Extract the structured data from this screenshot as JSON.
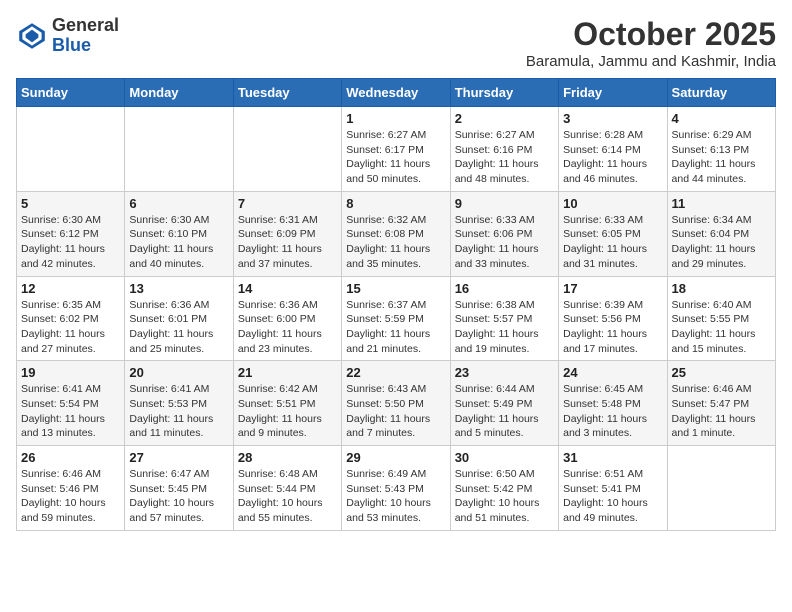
{
  "header": {
    "logo_general": "General",
    "logo_blue": "Blue",
    "month": "October 2025",
    "location": "Baramula, Jammu and Kashmir, India"
  },
  "weekdays": [
    "Sunday",
    "Monday",
    "Tuesday",
    "Wednesday",
    "Thursday",
    "Friday",
    "Saturday"
  ],
  "weeks": [
    [
      {
        "day": "",
        "info": ""
      },
      {
        "day": "",
        "info": ""
      },
      {
        "day": "",
        "info": ""
      },
      {
        "day": "1",
        "info": "Sunrise: 6:27 AM\nSunset: 6:17 PM\nDaylight: 11 hours\nand 50 minutes."
      },
      {
        "day": "2",
        "info": "Sunrise: 6:27 AM\nSunset: 6:16 PM\nDaylight: 11 hours\nand 48 minutes."
      },
      {
        "day": "3",
        "info": "Sunrise: 6:28 AM\nSunset: 6:14 PM\nDaylight: 11 hours\nand 46 minutes."
      },
      {
        "day": "4",
        "info": "Sunrise: 6:29 AM\nSunset: 6:13 PM\nDaylight: 11 hours\nand 44 minutes."
      }
    ],
    [
      {
        "day": "5",
        "info": "Sunrise: 6:30 AM\nSunset: 6:12 PM\nDaylight: 11 hours\nand 42 minutes."
      },
      {
        "day": "6",
        "info": "Sunrise: 6:30 AM\nSunset: 6:10 PM\nDaylight: 11 hours\nand 40 minutes."
      },
      {
        "day": "7",
        "info": "Sunrise: 6:31 AM\nSunset: 6:09 PM\nDaylight: 11 hours\nand 37 minutes."
      },
      {
        "day": "8",
        "info": "Sunrise: 6:32 AM\nSunset: 6:08 PM\nDaylight: 11 hours\nand 35 minutes."
      },
      {
        "day": "9",
        "info": "Sunrise: 6:33 AM\nSunset: 6:06 PM\nDaylight: 11 hours\nand 33 minutes."
      },
      {
        "day": "10",
        "info": "Sunrise: 6:33 AM\nSunset: 6:05 PM\nDaylight: 11 hours\nand 31 minutes."
      },
      {
        "day": "11",
        "info": "Sunrise: 6:34 AM\nSunset: 6:04 PM\nDaylight: 11 hours\nand 29 minutes."
      }
    ],
    [
      {
        "day": "12",
        "info": "Sunrise: 6:35 AM\nSunset: 6:02 PM\nDaylight: 11 hours\nand 27 minutes."
      },
      {
        "day": "13",
        "info": "Sunrise: 6:36 AM\nSunset: 6:01 PM\nDaylight: 11 hours\nand 25 minutes."
      },
      {
        "day": "14",
        "info": "Sunrise: 6:36 AM\nSunset: 6:00 PM\nDaylight: 11 hours\nand 23 minutes."
      },
      {
        "day": "15",
        "info": "Sunrise: 6:37 AM\nSunset: 5:59 PM\nDaylight: 11 hours\nand 21 minutes."
      },
      {
        "day": "16",
        "info": "Sunrise: 6:38 AM\nSunset: 5:57 PM\nDaylight: 11 hours\nand 19 minutes."
      },
      {
        "day": "17",
        "info": "Sunrise: 6:39 AM\nSunset: 5:56 PM\nDaylight: 11 hours\nand 17 minutes."
      },
      {
        "day": "18",
        "info": "Sunrise: 6:40 AM\nSunset: 5:55 PM\nDaylight: 11 hours\nand 15 minutes."
      }
    ],
    [
      {
        "day": "19",
        "info": "Sunrise: 6:41 AM\nSunset: 5:54 PM\nDaylight: 11 hours\nand 13 minutes."
      },
      {
        "day": "20",
        "info": "Sunrise: 6:41 AM\nSunset: 5:53 PM\nDaylight: 11 hours\nand 11 minutes."
      },
      {
        "day": "21",
        "info": "Sunrise: 6:42 AM\nSunset: 5:51 PM\nDaylight: 11 hours\nand 9 minutes."
      },
      {
        "day": "22",
        "info": "Sunrise: 6:43 AM\nSunset: 5:50 PM\nDaylight: 11 hours\nand 7 minutes."
      },
      {
        "day": "23",
        "info": "Sunrise: 6:44 AM\nSunset: 5:49 PM\nDaylight: 11 hours\nand 5 minutes."
      },
      {
        "day": "24",
        "info": "Sunrise: 6:45 AM\nSunset: 5:48 PM\nDaylight: 11 hours\nand 3 minutes."
      },
      {
        "day": "25",
        "info": "Sunrise: 6:46 AM\nSunset: 5:47 PM\nDaylight: 11 hours\nand 1 minute."
      }
    ],
    [
      {
        "day": "26",
        "info": "Sunrise: 6:46 AM\nSunset: 5:46 PM\nDaylight: 10 hours\nand 59 minutes."
      },
      {
        "day": "27",
        "info": "Sunrise: 6:47 AM\nSunset: 5:45 PM\nDaylight: 10 hours\nand 57 minutes."
      },
      {
        "day": "28",
        "info": "Sunrise: 6:48 AM\nSunset: 5:44 PM\nDaylight: 10 hours\nand 55 minutes."
      },
      {
        "day": "29",
        "info": "Sunrise: 6:49 AM\nSunset: 5:43 PM\nDaylight: 10 hours\nand 53 minutes."
      },
      {
        "day": "30",
        "info": "Sunrise: 6:50 AM\nSunset: 5:42 PM\nDaylight: 10 hours\nand 51 minutes."
      },
      {
        "day": "31",
        "info": "Sunrise: 6:51 AM\nSunset: 5:41 PM\nDaylight: 10 hours\nand 49 minutes."
      },
      {
        "day": "",
        "info": ""
      }
    ]
  ]
}
